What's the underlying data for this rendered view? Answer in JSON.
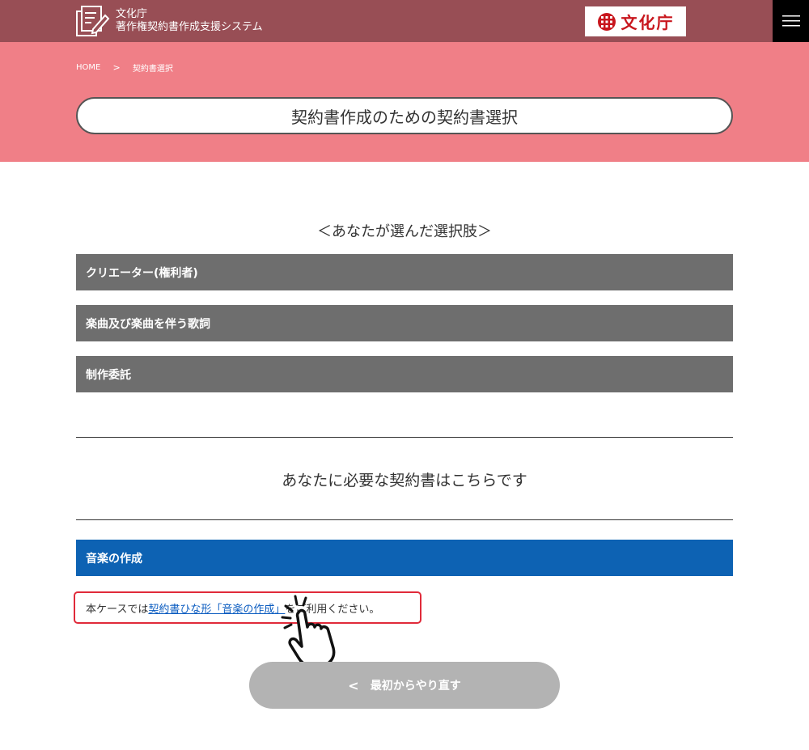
{
  "header": {
    "logo_line1": "文化庁",
    "logo_line2": "著作権契約書作成支援システム",
    "agency_name": "文化庁",
    "menu_icon": "hamburger-icon",
    "colors": {
      "header_bg": "#984e55",
      "band_bg": "#f07f87"
    }
  },
  "breadcrumb": {
    "home": "HOME",
    "separator": ">",
    "current": "契約書選択"
  },
  "page_title": "契約書作成のための契約書選択",
  "choices": {
    "heading": "＜あなたが選んだ選択肢＞",
    "items": [
      "クリエーター(権利者)",
      "楽曲及び楽曲を伴う歌詞",
      "制作委託"
    ]
  },
  "result": {
    "heading": "あなたに必要な契約書はこちらです",
    "contract_title": "音楽の作成",
    "note_prefix": "本ケースでは",
    "note_link": "契約書ひな形「音楽の作成」",
    "note_suffix": "をご利用ください。"
  },
  "restart_button": {
    "arrow": "<",
    "label": "最初からやり直す"
  },
  "decorations": {
    "pointer": "pointing-hand-icon"
  }
}
